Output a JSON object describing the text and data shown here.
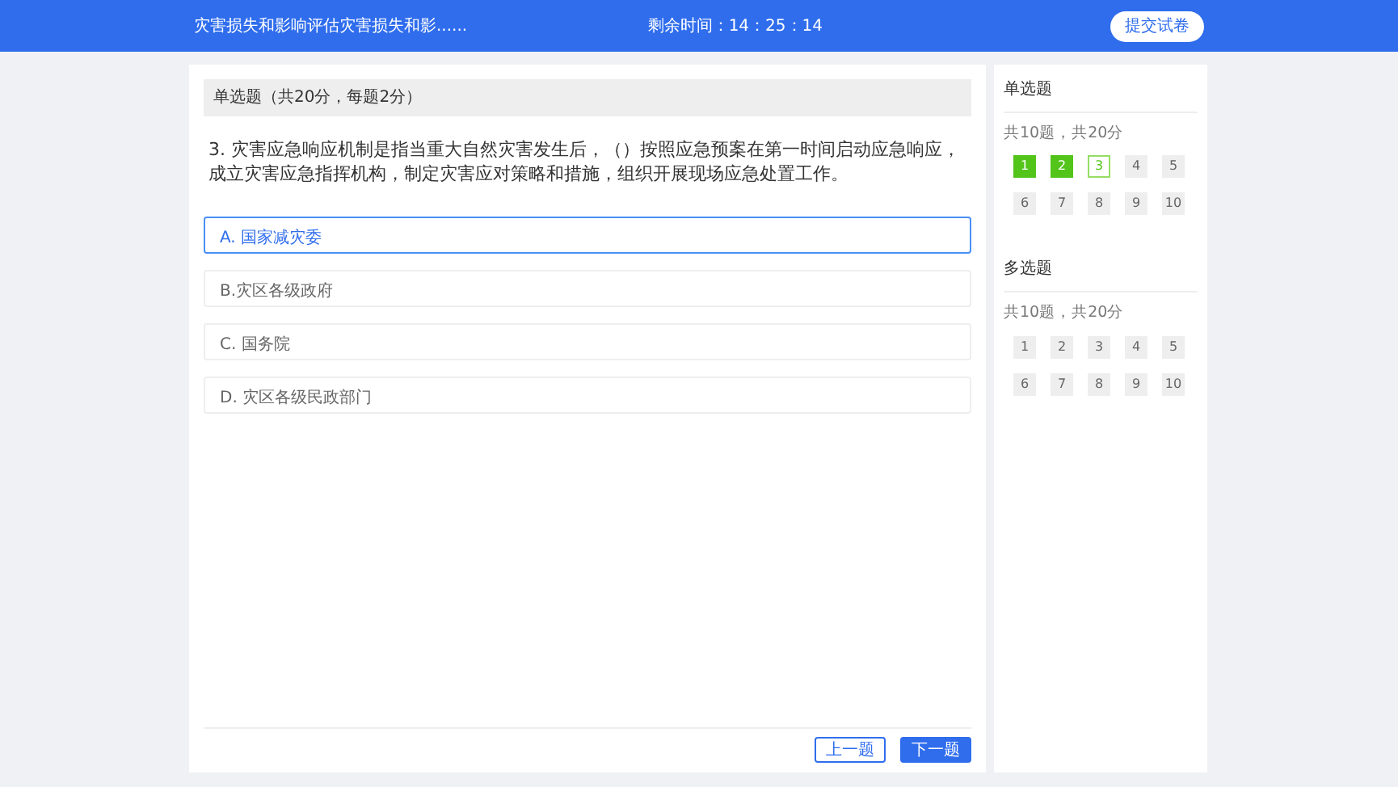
{
  "header": {
    "title": "灾害损失和影响评估灾害损失和影......",
    "timer": "剩余时间：14：25：14",
    "submit_button": "提交试卷"
  },
  "section_label": "单选题（共20分，每题2分）",
  "question": "3. 灾害应急响应机制是指当重大自然灾害发生后，（）按照应急预案在第一时间启动应急响应，成立灾害应急指挥机构，制定灾害应对策略和措施，组织开展现场应急处置工作。",
  "options": [
    {
      "label": "A. 国家减灾委",
      "selected": true
    },
    {
      "label": "B.灾区各级政府",
      "selected": false
    },
    {
      "label": "C. 国务院",
      "selected": false
    },
    {
      "label": "D. 灾区各级民政部门",
      "selected": false
    }
  ],
  "buttons": {
    "prev": "上一题",
    "next": "下一题"
  },
  "groups": [
    {
      "title": "单选题",
      "summary": "共10题，共20分",
      "items": [
        {
          "label": "1",
          "answered": true,
          "selected": false
        },
        {
          "label": "2",
          "answered": true,
          "selected": false
        },
        {
          "label": "3",
          "answered": false,
          "selected": true
        },
        {
          "label": "4",
          "answered": false,
          "selected": false
        },
        {
          "label": "5",
          "answered": false,
          "selected": false
        },
        {
          "label": "6",
          "answered": false,
          "selected": false
        },
        {
          "label": "7",
          "answered": false,
          "selected": false
        },
        {
          "label": "8",
          "answered": false,
          "selected": false
        },
        {
          "label": "9",
          "answered": false,
          "selected": false
        },
        {
          "label": "10",
          "answered": false,
          "selected": false
        }
      ]
    },
    {
      "title": "多选题",
      "summary": "共10题，共20分",
      "items": [
        {
          "label": "1",
          "answered": false,
          "selected": false
        },
        {
          "label": "2",
          "answered": false,
          "selected": false
        },
        {
          "label": "3",
          "answered": false,
          "selected": false
        },
        {
          "label": "4",
          "answered": false,
          "selected": false
        },
        {
          "label": "5",
          "answered": false,
          "selected": false
        },
        {
          "label": "6",
          "answered": false,
          "selected": false
        },
        {
          "label": "7",
          "answered": false,
          "selected": false
        },
        {
          "label": "8",
          "answered": false,
          "selected": false
        },
        {
          "label": "9",
          "answered": false,
          "selected": false
        },
        {
          "label": "10",
          "answered": false,
          "selected": false
        }
      ]
    }
  ]
}
